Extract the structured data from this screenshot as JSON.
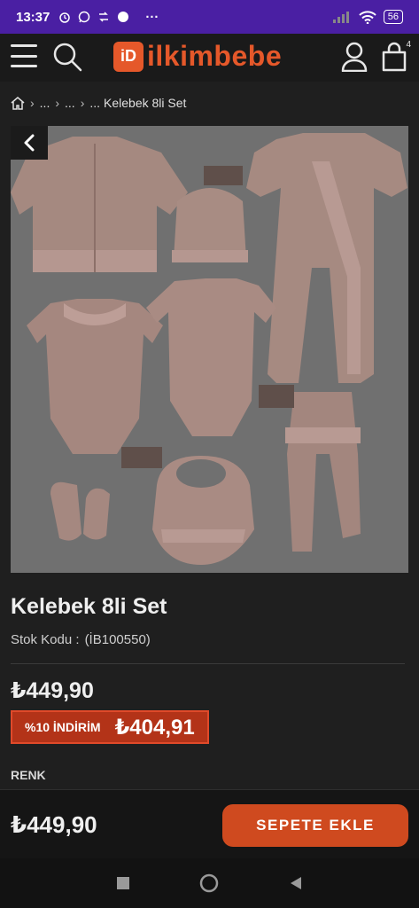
{
  "status_bar": {
    "time": "13:37",
    "dots": "···",
    "battery": "56"
  },
  "header": {
    "logo_badge": "iD",
    "logo_text": "ilkimbebe",
    "cart_count": "4"
  },
  "breadcrumb": {
    "items": [
      "...",
      "...",
      "..."
    ],
    "current": "Kelebek 8li Set"
  },
  "product": {
    "title": "Kelebek 8li Set",
    "sku_label": "Stok Kodu :",
    "sku_value": "(İB100550)",
    "price": "₺449,90",
    "discount_label": "%10 İNDİRİM",
    "discount_price": "₺404,91",
    "color_label": "RENK"
  },
  "bottom_bar": {
    "price": "₺449,90",
    "add_to_cart": "SEPETE EKLE"
  },
  "colors": {
    "accent": "#cf4a1f",
    "discount_bg": "#b33318",
    "status_bar": "#4a1fa3",
    "logo": "#e5582a"
  }
}
